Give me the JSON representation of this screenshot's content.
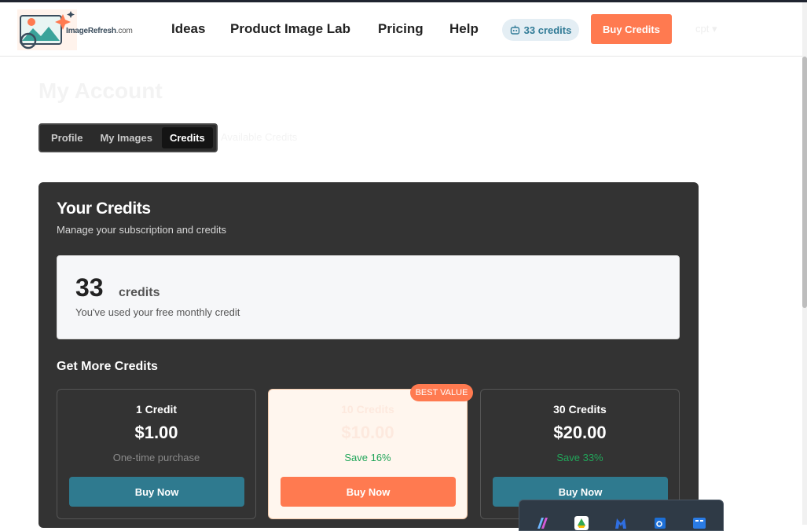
{
  "brand": {
    "name": "ImageRefresh",
    "domain": ".com"
  },
  "nav": [
    "Ideas",
    "Product Image Lab",
    "Pricing",
    "Help"
  ],
  "header": {
    "credits": "33 credits",
    "buy_label": "Buy Credits",
    "user_menu": "cpt  ▾"
  },
  "page": {
    "title": "My Account",
    "tabs": [
      "Profile",
      "My Images",
      "Credits"
    ],
    "active_tab": "Credits",
    "tab_caption": "Available Credits"
  },
  "credits_card": {
    "title": "Your Credits",
    "subtitle": "Manage your subscription and credits",
    "balance": "33",
    "balance_unit": "credits",
    "balance_note": "You've used your free monthly credit",
    "more_title": "Get More Credits"
  },
  "plans": [
    {
      "name": "1 Credit",
      "price": "$1.00",
      "note": "One-time purchase",
      "button": "Buy Now"
    },
    {
      "name": "10 Credits",
      "price": "$10.00",
      "note": "Save 16%",
      "button": "Buy Now",
      "badge": "BEST VALUE"
    },
    {
      "name": "30 Credits",
      "price": "$20.00",
      "note": "Save 33%",
      "button": "Buy Now"
    }
  ],
  "colors": {
    "accent": "#ff7a50",
    "teal": "#2f7a8f",
    "card": "#333333",
    "save": "#22a65a"
  },
  "taskbar_icons": [
    "copilot-icon",
    "google-drive-icon",
    "malwarebytes-icon",
    "outlook-icon",
    "app-icon"
  ]
}
